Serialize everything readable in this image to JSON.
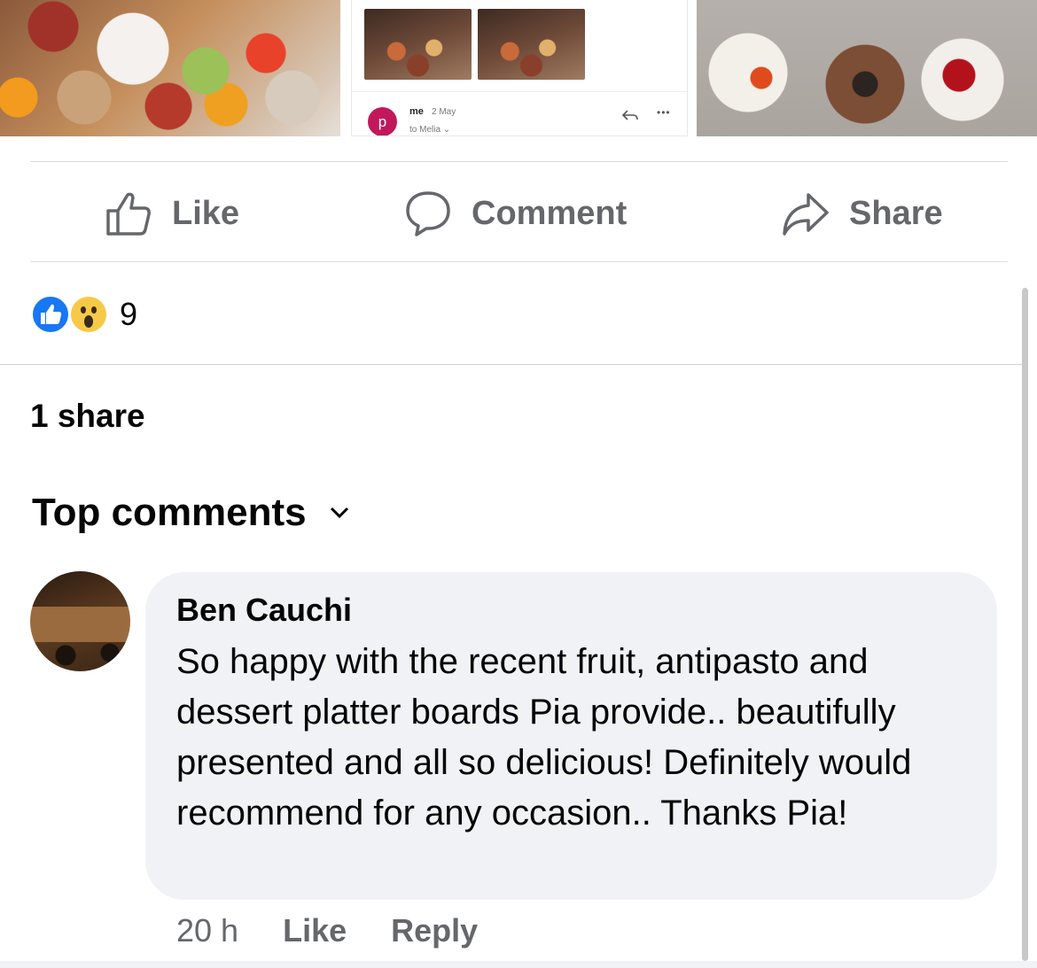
{
  "email_preview": {
    "avatar_letter": "p",
    "sender": "me",
    "date": "2 May",
    "recipient": "to Melia ⌄",
    "more": "•••"
  },
  "actions": {
    "like": "Like",
    "comment": "Comment",
    "share": "Share"
  },
  "reactions": {
    "count": "9",
    "types": [
      "like",
      "wow"
    ]
  },
  "shares": "1 share",
  "top_comments": "Top comments",
  "comment": {
    "author": "Ben Cauchi",
    "text": "So happy with the recent fruit, antipasto and dessert platter boards Pia provide.. beautifully presented and all so delicious! Definitely would recommend for any occasion.. Thanks Pia!",
    "time": "20 h",
    "like": "Like",
    "reply": "Reply"
  },
  "colors": {
    "action_gray": "#65676b",
    "like_blue": "#1877f2",
    "wow_yellow": "#f7c948",
    "bubble_bg": "#f0f2f5"
  }
}
